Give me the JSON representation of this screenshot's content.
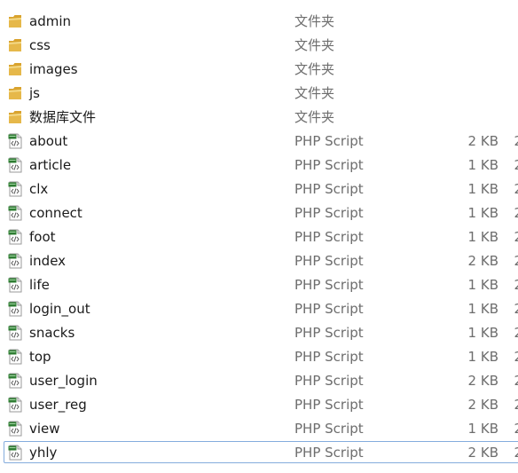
{
  "colors": {
    "folder": "#e6b84a",
    "php_badge": "#2e7d32",
    "selection_border": "#84acdd",
    "detail_text": "#6d6d6d"
  },
  "files": [
    {
      "name": "admin",
      "type": "文件夹",
      "size": "",
      "trail": "",
      "icon": "folder-icon"
    },
    {
      "name": "css",
      "type": "文件夹",
      "size": "",
      "trail": "",
      "icon": "folder-icon"
    },
    {
      "name": "images",
      "type": "文件夹",
      "size": "",
      "trail": "",
      "icon": "folder-icon"
    },
    {
      "name": "js",
      "type": "文件夹",
      "size": "",
      "trail": "",
      "icon": "folder-icon"
    },
    {
      "name": "数据库文件",
      "type": "文件夹",
      "size": "",
      "trail": "",
      "icon": "folder-icon"
    },
    {
      "name": "about",
      "type": "PHP Script",
      "size": "2 KB",
      "trail": "2",
      "icon": "php-file-icon"
    },
    {
      "name": "article",
      "type": "PHP Script",
      "size": "1 KB",
      "trail": "2",
      "icon": "php-file-icon"
    },
    {
      "name": "clx",
      "type": "PHP Script",
      "size": "1 KB",
      "trail": "2",
      "icon": "php-file-icon"
    },
    {
      "name": "connect",
      "type": "PHP Script",
      "size": "1 KB",
      "trail": "2",
      "icon": "php-file-icon"
    },
    {
      "name": "foot",
      "type": "PHP Script",
      "size": "1 KB",
      "trail": "2",
      "icon": "php-file-icon"
    },
    {
      "name": "index",
      "type": "PHP Script",
      "size": "2 KB",
      "trail": "2",
      "icon": "php-file-icon"
    },
    {
      "name": "life",
      "type": "PHP Script",
      "size": "1 KB",
      "trail": "2",
      "icon": "php-file-icon"
    },
    {
      "name": "login_out",
      "type": "PHP Script",
      "size": "1 KB",
      "trail": "2",
      "icon": "php-file-icon"
    },
    {
      "name": "snacks",
      "type": "PHP Script",
      "size": "1 KB",
      "trail": "2",
      "icon": "php-file-icon"
    },
    {
      "name": "top",
      "type": "PHP Script",
      "size": "1 KB",
      "trail": "2",
      "icon": "php-file-icon"
    },
    {
      "name": "user_login",
      "type": "PHP Script",
      "size": "2 KB",
      "trail": "2",
      "icon": "php-file-icon"
    },
    {
      "name": "user_reg",
      "type": "PHP Script",
      "size": "2 KB",
      "trail": "2",
      "icon": "php-file-icon"
    },
    {
      "name": "view",
      "type": "PHP Script",
      "size": "1 KB",
      "trail": "2",
      "icon": "php-file-icon"
    },
    {
      "name": "yhly",
      "type": "PHP Script",
      "size": "2 KB",
      "trail": "2",
      "icon": "php-file-icon",
      "selected": true
    }
  ]
}
